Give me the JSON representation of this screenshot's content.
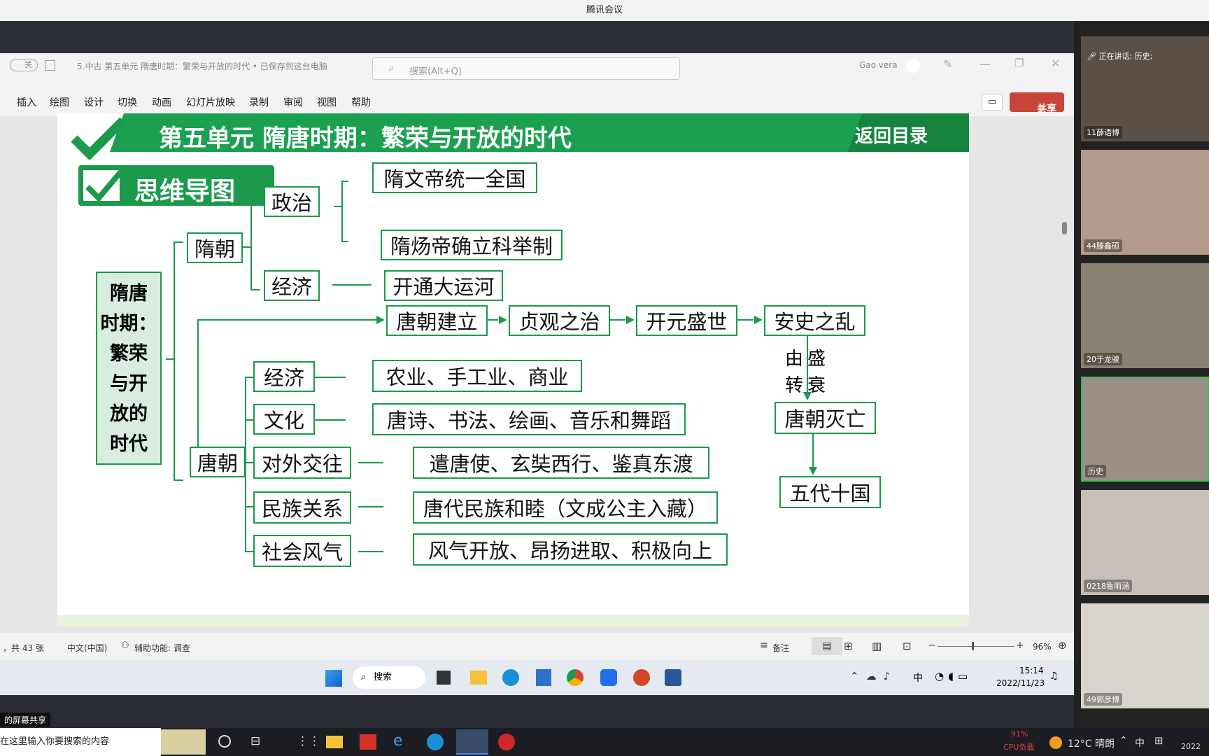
{
  "window_title": "腾讯会议",
  "ppt": {
    "autosave_label": "关",
    "doc_title": "5.中古 第五单元 隋唐时期：繁荣与开放的时代 • 已保存到这台电脑",
    "search_placeholder": "搜索(Alt+Q)",
    "user_name": "Gao vera",
    "share_label": "共享",
    "ribbon_tabs": [
      "插入",
      "绘图",
      "设计",
      "切换",
      "动画",
      "幻灯片放映",
      "录制",
      "审阅",
      "视图",
      "帮助"
    ],
    "status_slide": "，共 43 张",
    "status_lang": "中文(中国)",
    "status_access": "辅助功能: 调查",
    "status_notes": "备注",
    "zoom": "96%"
  },
  "slide": {
    "banner_title": "第五单元 隋唐时期：繁荣与开放的时代",
    "back_link": "返回目录",
    "mindmap_label": "思维导图",
    "root_lines": [
      "隋唐",
      "时期：",
      "繁荣",
      "与开",
      "放的",
      "时代"
    ],
    "nodes": {
      "sui": "隋朝",
      "tang": "唐朝",
      "politics": "政治",
      "sui_econ": "经济",
      "sui_pol1": "隋文帝统一全国",
      "sui_pol2": "隋炀帝确立科举制",
      "sui_econ1": "开通大运河",
      "chain1": "唐朝建立",
      "chain2": "贞观之治",
      "chain3": "开元盛世",
      "chain4": "安史之乱",
      "decline_a": "由盛",
      "decline_b": "转衰",
      "tang_fall": "唐朝灭亡",
      "five_dyn": "五代十国",
      "t_econ": "经济",
      "t_econ_v": "农业、手工业、商业",
      "t_cult": "文化",
      "t_cult_v": "唐诗、书法、绘画、音乐和舞蹈",
      "t_foreign": "对外交往",
      "t_foreign_v": "遣唐使、玄奘西行、鉴真东渡",
      "t_ethnic": "民族关系",
      "t_ethnic_v": "唐代民族和睦（文成公主入藏）",
      "t_social": "社会风气",
      "t_social_v": "风气开放、昂扬进取、积极向上"
    }
  },
  "gallery": {
    "speaking": "正在讲话: 历史;",
    "participants": [
      "11薛语博",
      "44滕鑫硕",
      "20于龙骏",
      "历史",
      "0218鲁雨涵",
      "49郭彦博"
    ]
  },
  "taskbar": {
    "search_label": "搜索",
    "time": "15:14",
    "date": "2022/11/23",
    "ime": "中"
  },
  "bottom_bar": {
    "screen_share_tag": "的屏幕共享",
    "search_box": "在这里输入你要搜索的内容",
    "cpu_pct": "91%",
    "cpu_label": "CPU负载",
    "weather": "12°C 晴朗",
    "ime": "中",
    "year_fragment": "2022"
  },
  "colors": {
    "accent_green": "#1a9a4a",
    "share_red": "#c8453a"
  }
}
